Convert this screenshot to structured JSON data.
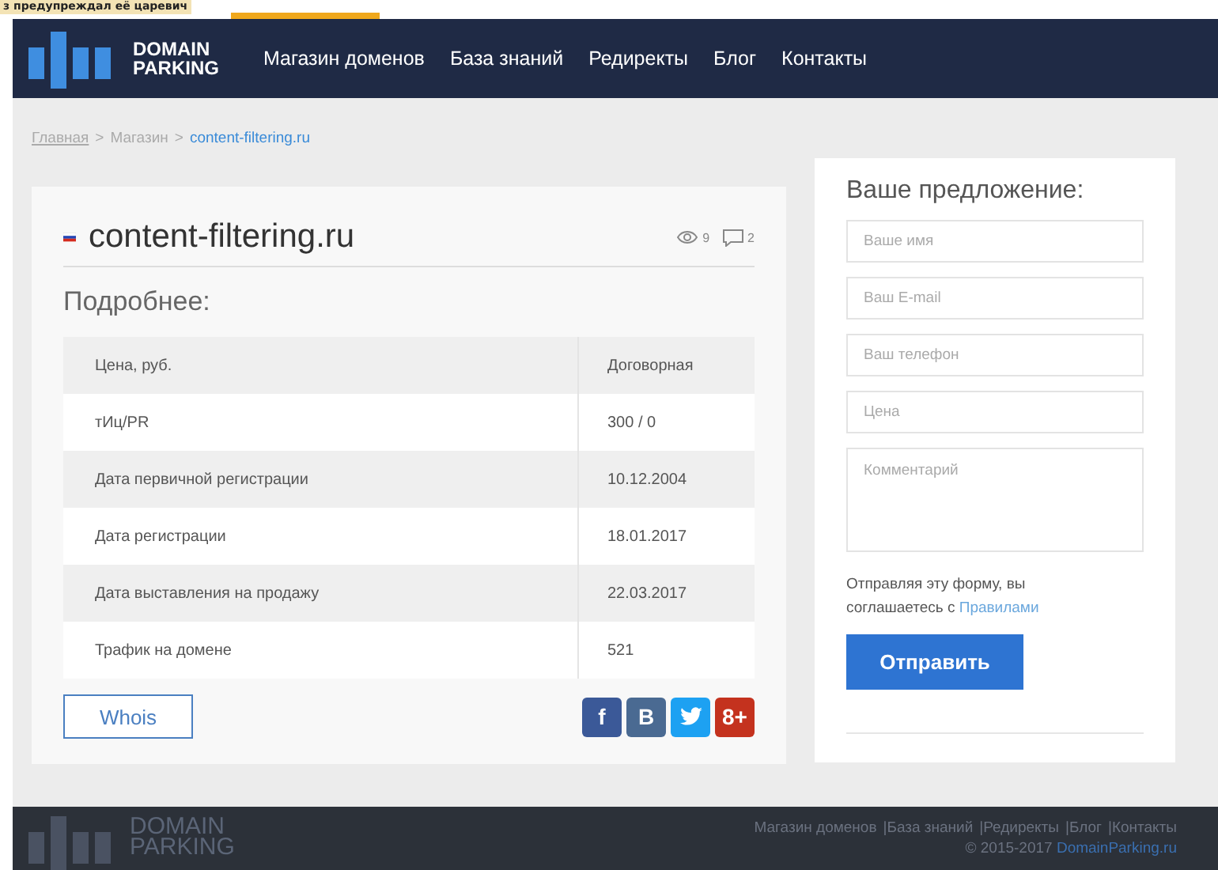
{
  "overlay_snippet": {
    "text": "з предупреждал её царевич"
  },
  "header": {
    "logo": {
      "line1": "DOMAIN",
      "line2": "PARKING"
    },
    "nav": [
      "Магазин доменов",
      "База знаний",
      "Редиректы",
      "Блог",
      "Контакты"
    ]
  },
  "breadcrumb": [
    {
      "label": "Главная",
      "kind": "link"
    },
    {
      "label": ">",
      "kind": "sep"
    },
    {
      "label": "Магазин",
      "kind": "text"
    },
    {
      "label": ">",
      "kind": "sep"
    },
    {
      "label": "content-filtering.ru",
      "kind": "current"
    }
  ],
  "domain": {
    "name": "content-filtering.ru",
    "views": "9",
    "comments": "2"
  },
  "details": {
    "title": "Подробнее:",
    "rows": [
      {
        "label": "Цена, руб.",
        "value": "Договорная"
      },
      {
        "label": "тИц/PR",
        "value": "300 / 0"
      },
      {
        "label": "Дата первичной регистрации",
        "value": "10.12.2004"
      },
      {
        "label": "Дата регистрации",
        "value": "18.01.2017"
      },
      {
        "label": "Дата выставления на продажу",
        "value": "22.03.2017"
      },
      {
        "label": "Трафик на домене",
        "value": "521"
      }
    ]
  },
  "whois_button": "Whois",
  "share": [
    {
      "kind": "facebook",
      "label": "f",
      "color": "#3b5998"
    },
    {
      "kind": "vk",
      "label": "B",
      "color": "#4a6a92"
    },
    {
      "kind": "twitter",
      "color": "#1da1f2"
    },
    {
      "kind": "gplus",
      "label": "8+",
      "color": "#c4321e"
    }
  ],
  "offer_form": {
    "title": "Ваше предложение:",
    "fields": [
      {
        "placeholder": "Ваше имя",
        "kind": "input"
      },
      {
        "placeholder": "Ваш E-mail",
        "kind": "input"
      },
      {
        "placeholder": "Ваш телефон",
        "kind": "input"
      },
      {
        "placeholder": "Цена",
        "kind": "input"
      },
      {
        "placeholder": "Комментарий",
        "kind": "textarea"
      }
    ],
    "agreement": "Отправляя эту форму, вы соглашаетесь с",
    "agreement_link": "Правилами",
    "submit": "Отправить"
  },
  "footer": {
    "logo": {
      "line1": "DOMAIN",
      "line2": "PARKING"
    },
    "links": [
      "Магазин доменов",
      "|База знаний",
      "|Редиректы",
      "|Блог",
      "|Контакты"
    ],
    "copyright": "© 2015-2017",
    "copyright_link": "DomainParking.ru"
  }
}
